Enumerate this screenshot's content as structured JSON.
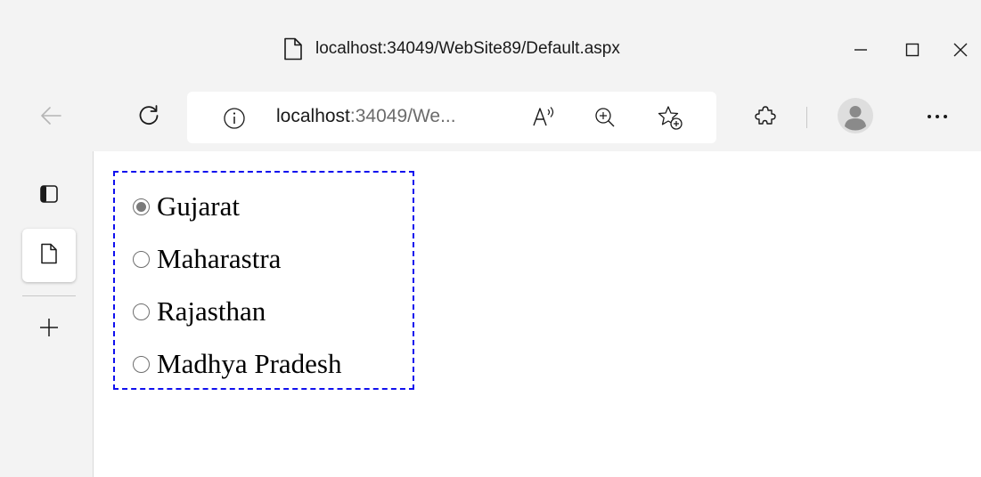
{
  "window": {
    "title": "localhost:34049/WebSite89/Default.aspx"
  },
  "toolbar": {
    "address_host": "localhost",
    "address_rest": ":34049/We..."
  },
  "radio_list": {
    "items": [
      {
        "label": "Gujarat",
        "selected": true
      },
      {
        "label": "Maharastra",
        "selected": false
      },
      {
        "label": "Rajasthan",
        "selected": false
      },
      {
        "label": "Madhya Pradesh",
        "selected": false
      }
    ]
  },
  "icons": {
    "title_page": "page-icon",
    "minimize": "minimize-icon",
    "maximize": "maximize-icon",
    "close": "close-icon",
    "back": "back-arrow-icon",
    "refresh": "refresh-icon",
    "info": "info-icon",
    "read_aloud": "read-aloud-icon",
    "zoom": "zoom-in-icon",
    "favorites": "add-favorite-icon",
    "extensions": "extensions-icon",
    "profile": "profile-avatar",
    "more": "more-options-icon",
    "tab_actions": "tab-actions-icon",
    "tab_page": "page-icon",
    "new_tab": "plus-icon"
  },
  "colors": {
    "chrome_bg": "#f3f3f3",
    "list_border": "#1010ee",
    "radio_selected": "#7a7a7a"
  }
}
